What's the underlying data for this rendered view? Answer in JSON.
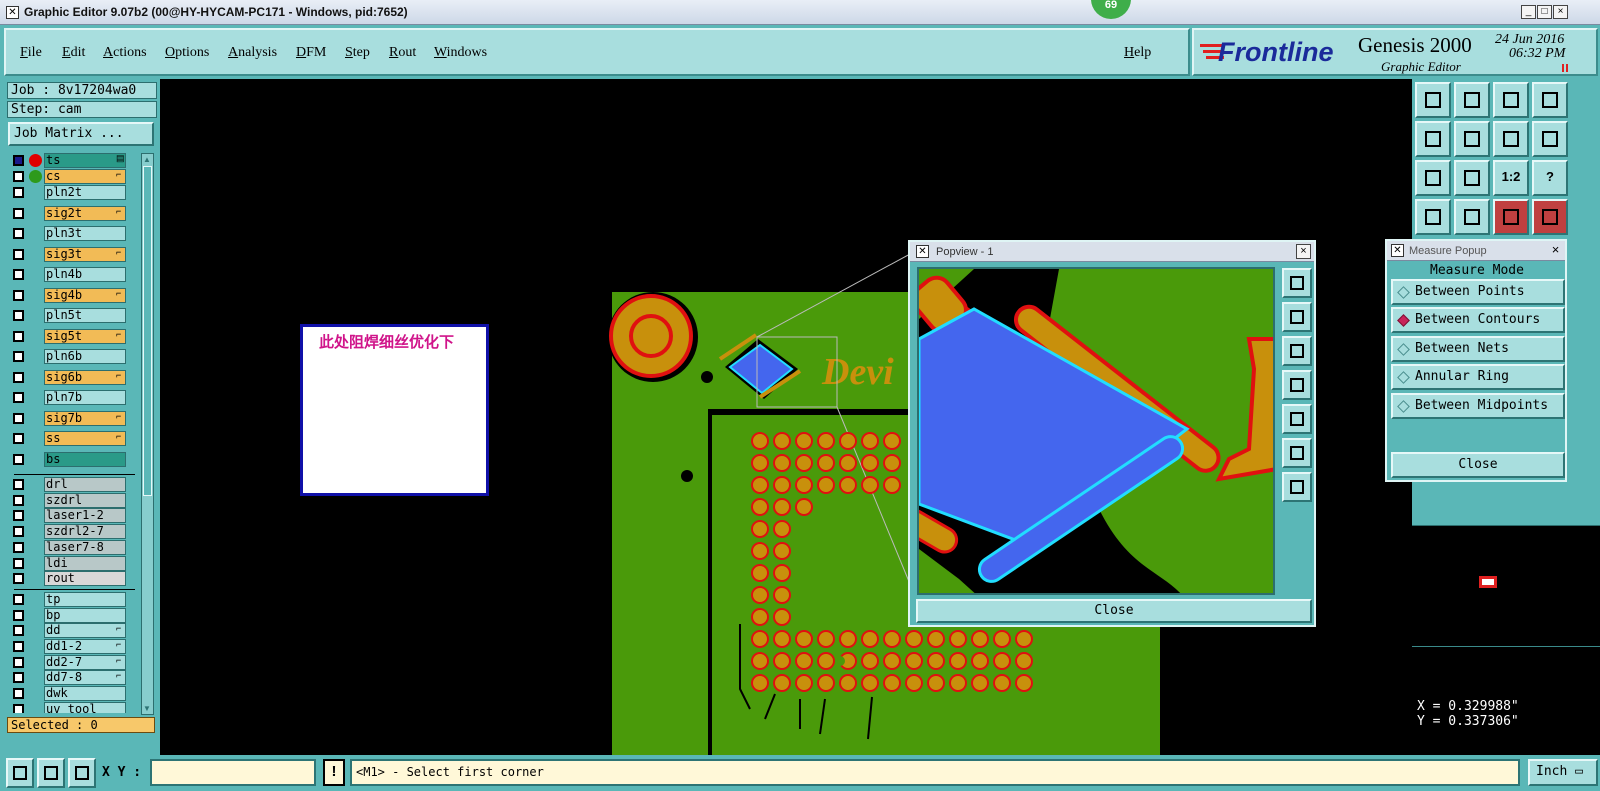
{
  "window": {
    "title": "Graphic Editor 9.07b2 (00@HY-HYCAM-PC171 - Windows, pid:7652)",
    "badge": "69",
    "minimize": "_",
    "maximize": "□",
    "close": "×"
  },
  "menu": {
    "items": [
      "File",
      "Edit",
      "Actions",
      "Options",
      "Analysis",
      "DFM",
      "Step",
      "Rout",
      "Windows"
    ],
    "help": "Help"
  },
  "branding": {
    "logo": "Frontline",
    "product": "Genesis 2000",
    "subtitle": "Graphic Editor",
    "date": "24 Jun 2016",
    "time": "06:32 PM"
  },
  "job": {
    "job_label": "Job : 8v17204wa0",
    "step_label": "Step: cam",
    "matrix_button": "Job Matrix ..."
  },
  "layers": [
    {
      "name": "ts",
      "color": "#2a9a88",
      "indicator": "#e00000",
      "flame": "▤"
    },
    {
      "name": "cs",
      "color": "#f2bb56",
      "indicator": "#2e9a1c",
      "flame": "⌐"
    },
    {
      "name": "pln2t",
      "color": "#a8dede"
    },
    {
      "name": "sig2t",
      "color": "#f2bb56",
      "flame": "⌐"
    },
    {
      "name": "pln3t",
      "color": "#a8dede"
    },
    {
      "name": "sig3t",
      "color": "#f2bb56",
      "flame": "⌐"
    },
    {
      "name": "pln4b",
      "color": "#a8dede"
    },
    {
      "name": "sig4b",
      "color": "#f2bb56",
      "flame": "⌐"
    },
    {
      "name": "pln5t",
      "color": "#a8dede"
    },
    {
      "name": "sig5t",
      "color": "#f2bb56",
      "flame": "⌐"
    },
    {
      "name": "pln6b",
      "color": "#a8dede"
    },
    {
      "name": "sig6b",
      "color": "#f2bb56",
      "flame": "⌐"
    },
    {
      "name": "pln7b",
      "color": "#a8dede"
    },
    {
      "name": "sig7b",
      "color": "#f2bb56",
      "flame": "⌐"
    },
    {
      "name": "ss",
      "color": "#f2bb56",
      "flame": "⌐"
    },
    {
      "name": "bs",
      "color": "#2a9a88"
    },
    {
      "name": "drl",
      "color": "#b8c8c8"
    },
    {
      "name": "szdrl",
      "color": "#b8c8c8"
    },
    {
      "name": "laser1-2",
      "color": "#b8c8c8"
    },
    {
      "name": "szdrl2-7",
      "color": "#b8c8c8"
    },
    {
      "name": "laser7-8",
      "color": "#b8c8c8"
    },
    {
      "name": "ldi",
      "color": "#b8c8c8"
    },
    {
      "name": "rout",
      "color": "#d8d8d8"
    },
    {
      "name": "tp",
      "color": "#a8dede"
    },
    {
      "name": "bp",
      "color": "#a8dede"
    },
    {
      "name": "dd",
      "color": "#a8dede",
      "flame": "⌐"
    },
    {
      "name": "dd1-2",
      "color": "#a8dede",
      "flame": "⌐"
    },
    {
      "name": "dd2-7",
      "color": "#a8dede",
      "flame": "⌐"
    },
    {
      "name": "dd7-8",
      "color": "#a8dede",
      "flame": "⌐"
    },
    {
      "name": "dwk",
      "color": "#a8dede"
    },
    {
      "name": "uv_tool",
      "color": "#a8dede"
    }
  ],
  "selected": "Selected : 0",
  "note": {
    "text": "此处阻焊细丝优化下"
  },
  "popview": {
    "title": "Popview - 1",
    "close_label": "Close",
    "close_x": "×"
  },
  "measure": {
    "title": "Measure Popup",
    "close_x": "×",
    "mode_label": "Measure Mode",
    "options": [
      "Between Points",
      "Between Contours",
      "Between Nets",
      "Annular Ring",
      "Between Midpoints"
    ],
    "selected_index": 1,
    "close_label": "Close"
  },
  "toolbar_right": {
    "one_to_two": "1:2",
    "help_q": "?"
  },
  "coords": {
    "x": "X = 0.329988\"",
    "y": "Y = 0.337306\""
  },
  "status": {
    "xy_label": "X Y :",
    "xy_value": "",
    "warn": "!",
    "prompt": "<M1> - Select first corner",
    "units": "Inch ▭"
  },
  "colors": {
    "panel": "#5ab7b7",
    "panel_light": "#a8dede",
    "pcb_green": "#4a9a0a",
    "pad_gold": "#c8900c",
    "pad_red": "#e01010",
    "selection_blue": "#4466ee",
    "selection_cyan": "#22ddff",
    "note_text": "#d0148a"
  }
}
